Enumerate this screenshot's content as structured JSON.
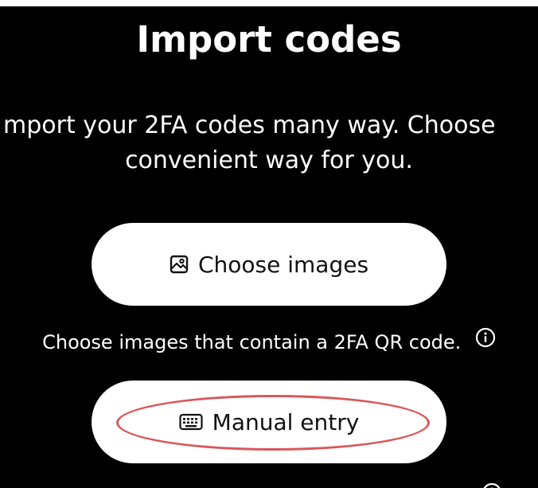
{
  "page": {
    "title": "Import codes",
    "description_line1": "mport your 2FA codes many way. Choose",
    "description_line2": "convenient way for you."
  },
  "buttons": {
    "choose_images": {
      "label": "Choose images",
      "icon": "image-icon"
    },
    "manual_entry": {
      "label": "Manual entry",
      "icon": "keyboard-icon"
    }
  },
  "hints": {
    "choose_images_hint": "Choose images that contain a 2FA QR code.",
    "hint_icon": "info-icon"
  },
  "colors": {
    "background": "#000000",
    "button_bg": "#ffffff",
    "text_light": "#ffffff",
    "text_dark": "#111111",
    "annotation": "#d9575b"
  }
}
